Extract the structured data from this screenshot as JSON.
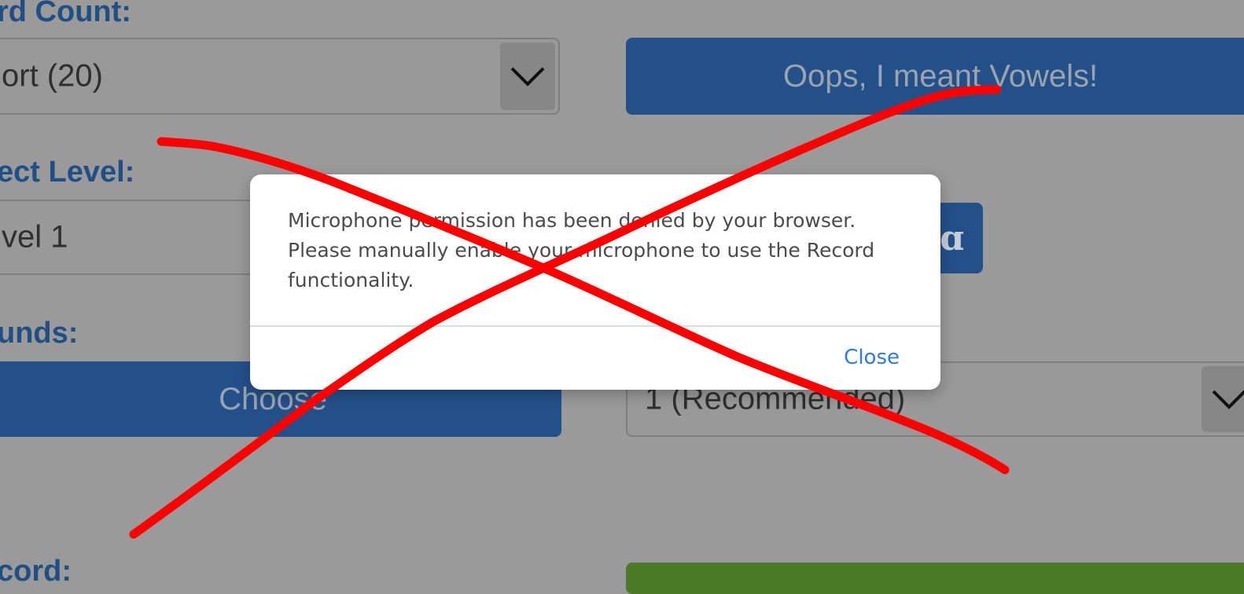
{
  "labels": {
    "word_count": "rd Count:",
    "select_level": "ect Level:",
    "sounds": "unds:",
    "record": "cord:"
  },
  "word_count_select": {
    "value": "ort (20)"
  },
  "vowels_button": {
    "label": "Oops, I meant Vowels!"
  },
  "level_select": {
    "value": "vel 1"
  },
  "font_toggle_button": {
    "glyph": "ɑ"
  },
  "sounds_button": {
    "label": "Choose"
  },
  "repetitions_select": {
    "value": "1 (Recommended)"
  },
  "dialog": {
    "message": "Microphone permission has been denied by your browser. Please manually enable your microphone to use the Record functionality.",
    "close_label": "Close"
  },
  "colors": {
    "label_blue": "#1f4f84",
    "button_blue": "#24508a",
    "record_green": "#4d7a29",
    "backdrop": "#9a9a9a",
    "link_blue": "#2f7be0",
    "annotation_red": "#ff0000"
  },
  "icons": {
    "dropdown": "chevron-down-icon",
    "annotation": "red-x-annotation"
  }
}
